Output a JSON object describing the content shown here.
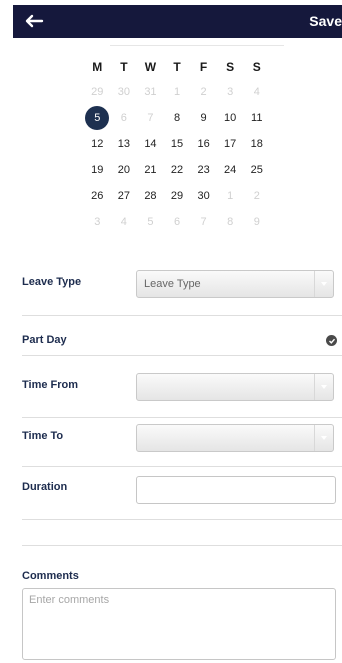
{
  "header": {
    "save_label": "Save"
  },
  "calendar": {
    "weekdays": [
      "M",
      "T",
      "W",
      "T",
      "F",
      "S",
      "S"
    ],
    "weeks": [
      [
        {
          "d": "29",
          "m": true
        },
        {
          "d": "30",
          "m": true
        },
        {
          "d": "31",
          "m": true
        },
        {
          "d": "1",
          "m": true
        },
        {
          "d": "2",
          "m": true
        },
        {
          "d": "3",
          "m": true
        },
        {
          "d": "4",
          "m": true
        }
      ],
      [
        {
          "d": "5",
          "sel": true
        },
        {
          "d": "6",
          "m": true
        },
        {
          "d": "7",
          "m": true
        },
        {
          "d": "8"
        },
        {
          "d": "9"
        },
        {
          "d": "10"
        },
        {
          "d": "11"
        }
      ],
      [
        {
          "d": "12"
        },
        {
          "d": "13"
        },
        {
          "d": "14"
        },
        {
          "d": "15"
        },
        {
          "d": "16"
        },
        {
          "d": "17"
        },
        {
          "d": "18"
        }
      ],
      [
        {
          "d": "19"
        },
        {
          "d": "20"
        },
        {
          "d": "21"
        },
        {
          "d": "22"
        },
        {
          "d": "23"
        },
        {
          "d": "24"
        },
        {
          "d": "25"
        }
      ],
      [
        {
          "d": "26"
        },
        {
          "d": "27"
        },
        {
          "d": "28"
        },
        {
          "d": "29"
        },
        {
          "d": "30"
        },
        {
          "d": "1",
          "m": true
        },
        {
          "d": "2",
          "m": true
        }
      ],
      [
        {
          "d": "3",
          "m": true
        },
        {
          "d": "4",
          "m": true
        },
        {
          "d": "5",
          "m": true
        },
        {
          "d": "6",
          "m": true
        },
        {
          "d": "7",
          "m": true
        },
        {
          "d": "8",
          "m": true
        },
        {
          "d": "9",
          "m": true
        }
      ]
    ]
  },
  "form": {
    "leave_type_label": "Leave Type",
    "leave_type_value": "Leave Type",
    "part_day_label": "Part Day",
    "time_from_label": "Time From",
    "time_from_value": "",
    "time_to_label": "Time To",
    "time_to_value": "",
    "duration_label": "Duration",
    "duration_value": "",
    "comments_label": "Comments",
    "comments_placeholder": "Enter comments"
  }
}
